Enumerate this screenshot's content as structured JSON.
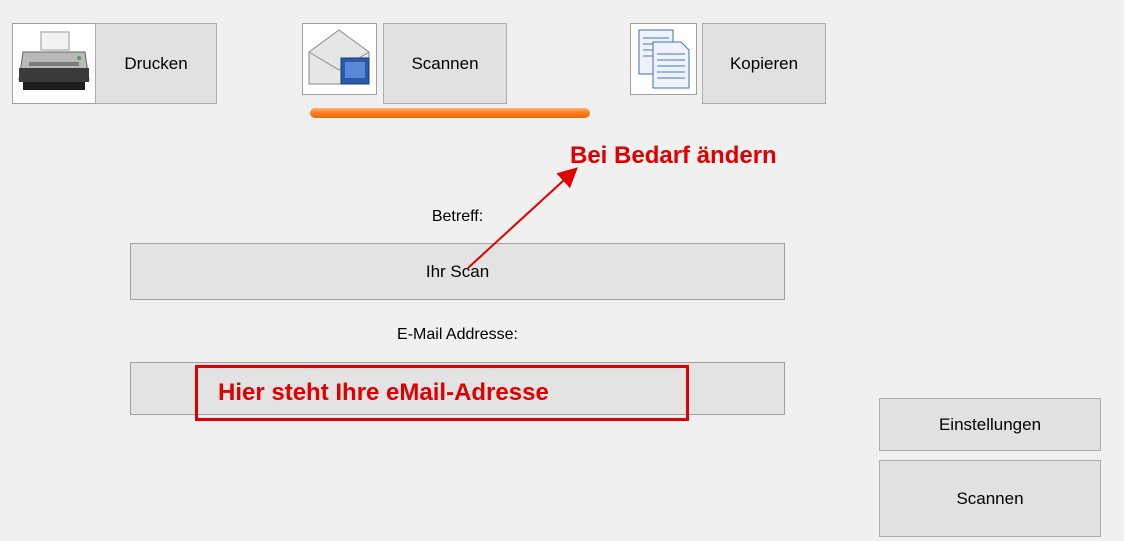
{
  "toolbar": {
    "print_label": "Drucken",
    "scan_label": "Scannen",
    "copy_label": "Kopieren"
  },
  "form": {
    "subject_label": "Betreff:",
    "subject_value": "Ihr Scan",
    "email_label": "E-Mail Addresse:",
    "email_value": ""
  },
  "actions": {
    "settings_label": "Einstellungen",
    "scan_label": "Scannen"
  },
  "annotations": {
    "change_hint": "Bei Bedarf ändern",
    "email_hint": "Hier steht Ihre eMail-Adresse",
    "color": "#e00000"
  },
  "active_tab": "scan",
  "accent_color": "#ff7a1a",
  "icons": [
    "printer-icon",
    "mail-scan-icon",
    "documents-copy-icon"
  ]
}
